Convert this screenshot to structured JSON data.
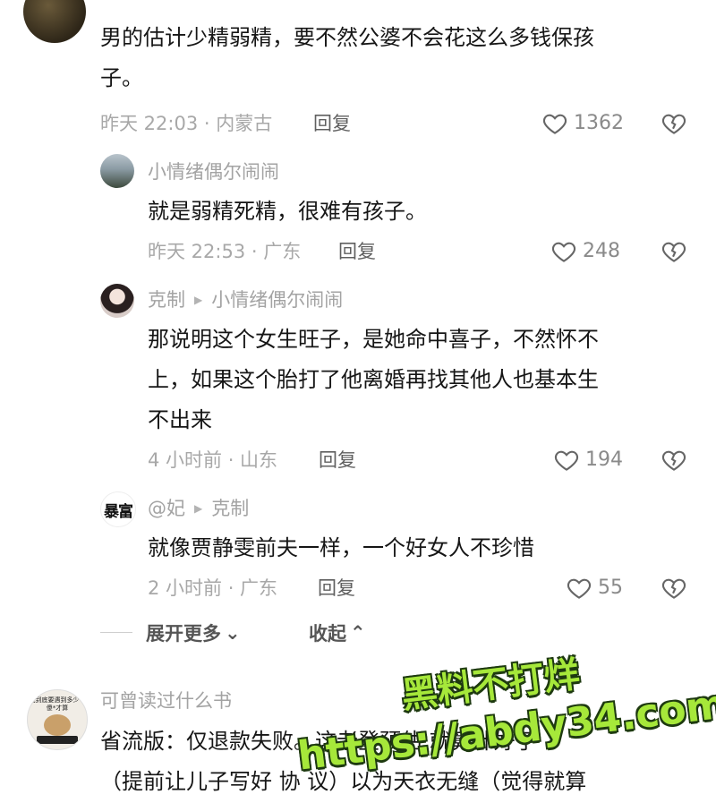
{
  "comments": [
    {
      "text_lines": [
        "男的估计少精弱精，要不然公婆不会花这么多钱保孩",
        "子。"
      ],
      "meta": "昨天 22:03 · 内蒙古",
      "reply_label": "回复",
      "likes": "1362"
    },
    {
      "author": "小情绪偶尔闹闹",
      "text_lines": [
        "就是弱精死精，很难有孩子。"
      ],
      "meta": "昨天 22:53 · 广东",
      "reply_label": "回复",
      "likes": "248"
    },
    {
      "author": "克制",
      "reply_to": "小情绪偶尔闹闹",
      "text_lines": [
        "那说明这个女生旺子，是她命中喜子，不然怀不",
        "上，如果这个胎打了他离婚再找其他人也基本生",
        "不出来"
      ],
      "meta": "4 小时前 · 山东",
      "reply_label": "回复",
      "likes": "194"
    },
    {
      "author": "@妃",
      "reply_to": "克制",
      "avatar_text": "暴富",
      "text_lines": [
        "就像贾静雯前夫一样，一个好女人不珍惜"
      ],
      "meta": "2 小时前 · 广东",
      "reply_label": "回复",
      "likes": "55"
    },
    {
      "author": "可曾读过什么书",
      "avatar_text": "我到底要遇到多少个傻*才算",
      "text_lines": [
        "省流版：仅退款失败。这老登预估 就算计好了",
        "（提前让儿子写好 协 议）以为天衣无缝（觉得就算"
      ]
    }
  ],
  "thread_controls": {
    "expand_label": "展开更多",
    "collapse_label": "收起"
  },
  "watermark": {
    "line1": "黑料不打烊",
    "line2": "https://abdy34.com"
  }
}
